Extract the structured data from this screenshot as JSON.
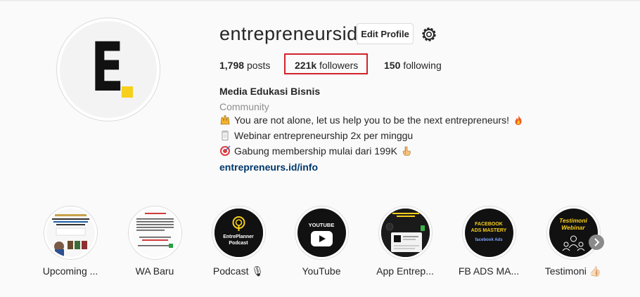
{
  "profile": {
    "username": "entrepreneursid_",
    "edit_label": "Edit Profile",
    "avatar_letter": "E",
    "avatar_accent": "#f7cf1d"
  },
  "stats": {
    "posts_count": "1,798",
    "posts_label": "posts",
    "followers_count": "221k",
    "followers_label": "followers",
    "following_count": "150",
    "following_label": "following",
    "highlight_color": "#d2232a"
  },
  "bio": {
    "name": "Media Edukasi Bisnis",
    "category": "Community",
    "line1": "You are not alone, let us help you to be the next entrepreneurs!",
    "line2": "Webinar entrepreneurship 2x per minggu",
    "line3": "Gabung membership mulai dari 199K",
    "link": "entrepreneurs.id/info",
    "link_color": "#00376b"
  },
  "highlights": [
    {
      "label": "Upcoming ..."
    },
    {
      "label": "WA Baru"
    },
    {
      "label": "Podcast 🎙",
      "text1": "EntrePlanner",
      "text2": "Podcast"
    },
    {
      "label": "YouTube",
      "text1": "YOUTUBE"
    },
    {
      "label": "App Entrep..."
    },
    {
      "label": "FB ADS MA...",
      "text1": "FACEBOOK",
      "text2": "ADS MASTERY",
      "text3": "facebook Ads"
    },
    {
      "label": "Testimoni 👍🏻",
      "text1": "Testimoni",
      "text2": "Webinar"
    }
  ],
  "icons": {
    "settings": "gear-icon",
    "next": "chevron-right-icon"
  }
}
